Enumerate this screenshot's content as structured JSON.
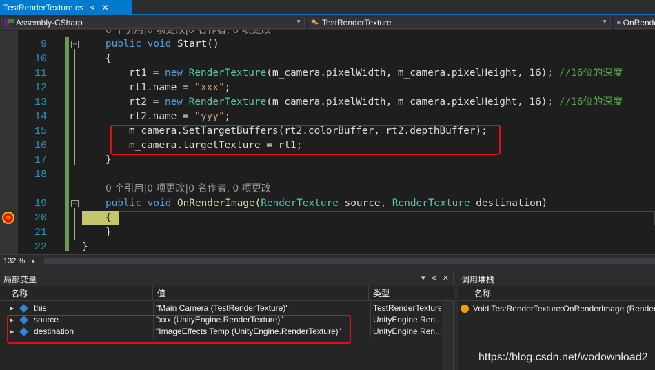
{
  "tab": {
    "title": "TestRenderTexture.cs",
    "pin": "⊲",
    "close": "✕"
  },
  "nav": {
    "project": "Assembly-CSharp",
    "class": "TestRenderTexture",
    "member": "OnRender"
  },
  "editor": {
    "lines": [
      {
        "num": "",
        "lens": "0 个引用|0 项更改|0 名作者, 0 项更改"
      },
      {
        "num": "9"
      },
      {
        "num": "10"
      },
      {
        "num": "11"
      },
      {
        "num": "12"
      },
      {
        "num": "13"
      },
      {
        "num": "14"
      },
      {
        "num": "15"
      },
      {
        "num": "16"
      },
      {
        "num": "17"
      },
      {
        "num": "18"
      },
      {
        "num": "",
        "lens": "0 个引用|0 项更改|0 名作者, 0 项更改"
      },
      {
        "num": "19"
      },
      {
        "num": "20"
      },
      {
        "num": "21"
      },
      {
        "num": "22"
      }
    ],
    "code": {
      "l9_kw1": "public",
      "l9_kw2": "void",
      "l9_rest": " Start()",
      "l10": "{",
      "l11_a": "rt1 = ",
      "l11_kw": "new",
      "l11_ty": "RenderTexture",
      "l11_b": "(m_camera.pixelWidth, m_camera.pixelHeight, 16); ",
      "l11_cm": "//16位的深度",
      "l12_a": "rt1.name = ",
      "l12_str": "\"xxx\"",
      "l12_b": ";",
      "l13_a": "rt2 = ",
      "l13_kw": "new",
      "l13_ty": "RenderTexture",
      "l13_b": "(m_camera.pixelWidth, m_camera.pixelHeight, 16); ",
      "l13_cm": "//16位的深度",
      "l14_a": "rt2.name = ",
      "l14_str": "\"yyy\"",
      "l14_b": ";",
      "l15": "m_camera.SetTargetBuffers(rt2.colorBuffer, rt2.depthBuffer);",
      "l16": "m_camera.targetTexture = rt1;",
      "l17": "}",
      "l19_kw1": "public",
      "l19_kw2": "void",
      "l19_name": " OnRenderImage(",
      "l19_ty1": "RenderTexture",
      "l19_mid": " source, ",
      "l19_ty2": "RenderTexture",
      "l19_end": " destination)",
      "l20": "{",
      "l21": "}",
      "l22": "}"
    }
  },
  "zoom": {
    "value": "132 %"
  },
  "locals": {
    "title": "局部变量",
    "buttons": {
      "dropdown": "▾",
      "pin": "⊲",
      "close": "✕"
    },
    "headers": {
      "name": "名称",
      "value": "值",
      "type": "类型"
    },
    "rows": [
      {
        "name": "this",
        "value": "\"Main Camera (TestRenderTexture)\"",
        "type": "TestRenderTexture"
      },
      {
        "name": "source",
        "value": "\"xxx (UnityEngine.RenderTexture)\"",
        "type": "UnityEngine.Ren..."
      },
      {
        "name": "destination",
        "value": "\"ImageEffects Temp (UnityEngine.RenderTexture)\"",
        "type": "UnityEngine.Ren..."
      }
    ]
  },
  "callstack": {
    "title": "调用堆栈",
    "header_name": "名称",
    "row": "Void TestRenderTexture:OnRenderImage (RenderTe"
  },
  "watermark": "https://blog.csdn.net/wodownload2",
  "colors": {
    "accent": "#007acc",
    "keyword": "#569cd6",
    "type": "#4ec9b0",
    "string": "#d69d85",
    "comment": "#57a64a",
    "highlight_box": "#e01010"
  }
}
